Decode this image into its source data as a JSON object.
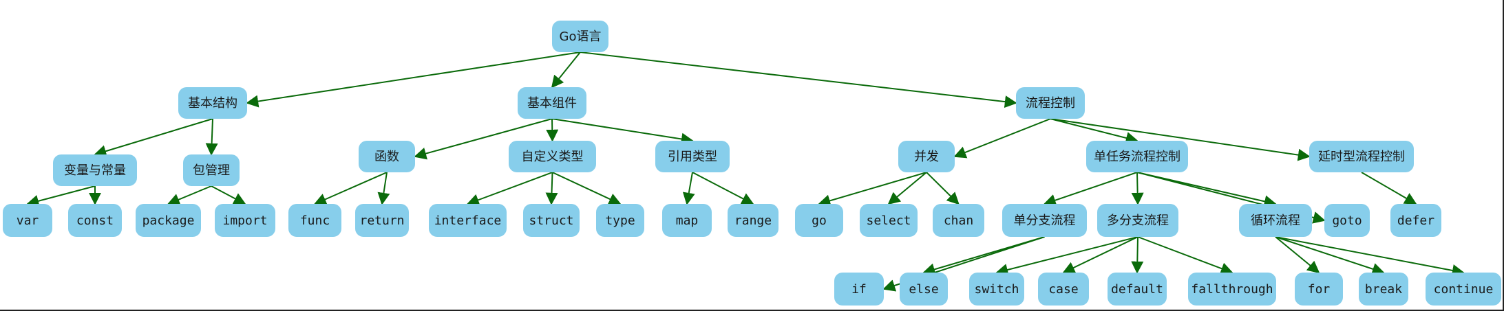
{
  "diagram": {
    "colors": {
      "node_fill": "#87ceeb",
      "edge": "#0a6a0a",
      "text": "#1a1a1a"
    },
    "nodes": [
      {
        "id": "root",
        "label": "Go语言"
      },
      {
        "id": "basic_structure",
        "label": "基本结构"
      },
      {
        "id": "basic_components",
        "label": "基本组件"
      },
      {
        "id": "flow_control",
        "label": "流程控制"
      },
      {
        "id": "var_const",
        "label": "变量与常量"
      },
      {
        "id": "pkg_mgmt",
        "label": "包管理"
      },
      {
        "id": "var",
        "label": "var"
      },
      {
        "id": "const",
        "label": "const"
      },
      {
        "id": "package",
        "label": "package"
      },
      {
        "id": "import",
        "label": "import"
      },
      {
        "id": "function",
        "label": "函数"
      },
      {
        "id": "custom_type",
        "label": "自定义类型"
      },
      {
        "id": "ref_type",
        "label": "引用类型"
      },
      {
        "id": "func",
        "label": "func"
      },
      {
        "id": "return",
        "label": "return"
      },
      {
        "id": "interface",
        "label": "interface"
      },
      {
        "id": "struct",
        "label": "struct"
      },
      {
        "id": "type",
        "label": "type"
      },
      {
        "id": "map",
        "label": "map"
      },
      {
        "id": "range",
        "label": "range"
      },
      {
        "id": "concurrency",
        "label": "并发"
      },
      {
        "id": "single_task",
        "label": "单任务流程控制"
      },
      {
        "id": "deferred",
        "label": "延时型流程控制"
      },
      {
        "id": "go",
        "label": "go"
      },
      {
        "id": "select",
        "label": "select"
      },
      {
        "id": "chan",
        "label": "chan"
      },
      {
        "id": "single_branch",
        "label": "单分支流程"
      },
      {
        "id": "multi_branch",
        "label": "多分支流程"
      },
      {
        "id": "loop",
        "label": "循环流程"
      },
      {
        "id": "goto",
        "label": "goto"
      },
      {
        "id": "defer",
        "label": "defer"
      },
      {
        "id": "if",
        "label": "if"
      },
      {
        "id": "else",
        "label": "else"
      },
      {
        "id": "switch",
        "label": "switch"
      },
      {
        "id": "case",
        "label": "case"
      },
      {
        "id": "default",
        "label": "default"
      },
      {
        "id": "fallthrough",
        "label": "fallthrough"
      },
      {
        "id": "for",
        "label": "for"
      },
      {
        "id": "break",
        "label": "break"
      },
      {
        "id": "continue",
        "label": "continue"
      }
    ],
    "edges": [
      [
        "root",
        "basic_structure"
      ],
      [
        "root",
        "basic_components"
      ],
      [
        "root",
        "flow_control"
      ],
      [
        "basic_structure",
        "var_const"
      ],
      [
        "basic_structure",
        "pkg_mgmt"
      ],
      [
        "var_const",
        "var"
      ],
      [
        "var_const",
        "const"
      ],
      [
        "pkg_mgmt",
        "package"
      ],
      [
        "pkg_mgmt",
        "import"
      ],
      [
        "basic_components",
        "function"
      ],
      [
        "basic_components",
        "custom_type"
      ],
      [
        "basic_components",
        "ref_type"
      ],
      [
        "function",
        "func"
      ],
      [
        "function",
        "return"
      ],
      [
        "custom_type",
        "interface"
      ],
      [
        "custom_type",
        "struct"
      ],
      [
        "custom_type",
        "type"
      ],
      [
        "ref_type",
        "map"
      ],
      [
        "ref_type",
        "range"
      ],
      [
        "flow_control",
        "concurrency"
      ],
      [
        "flow_control",
        "single_task"
      ],
      [
        "flow_control",
        "deferred"
      ],
      [
        "concurrency",
        "go"
      ],
      [
        "concurrency",
        "select"
      ],
      [
        "concurrency",
        "chan"
      ],
      [
        "single_task",
        "single_branch"
      ],
      [
        "single_task",
        "multi_branch"
      ],
      [
        "single_task",
        "loop"
      ],
      [
        "single_task",
        "goto"
      ],
      [
        "deferred",
        "defer"
      ],
      [
        "single_branch",
        "if"
      ],
      [
        "single_branch",
        "else"
      ],
      [
        "multi_branch",
        "switch"
      ],
      [
        "multi_branch",
        "case"
      ],
      [
        "multi_branch",
        "default"
      ],
      [
        "multi_branch",
        "fallthrough"
      ],
      [
        "loop",
        "for"
      ],
      [
        "loop",
        "break"
      ],
      [
        "loop",
        "continue"
      ]
    ]
  }
}
